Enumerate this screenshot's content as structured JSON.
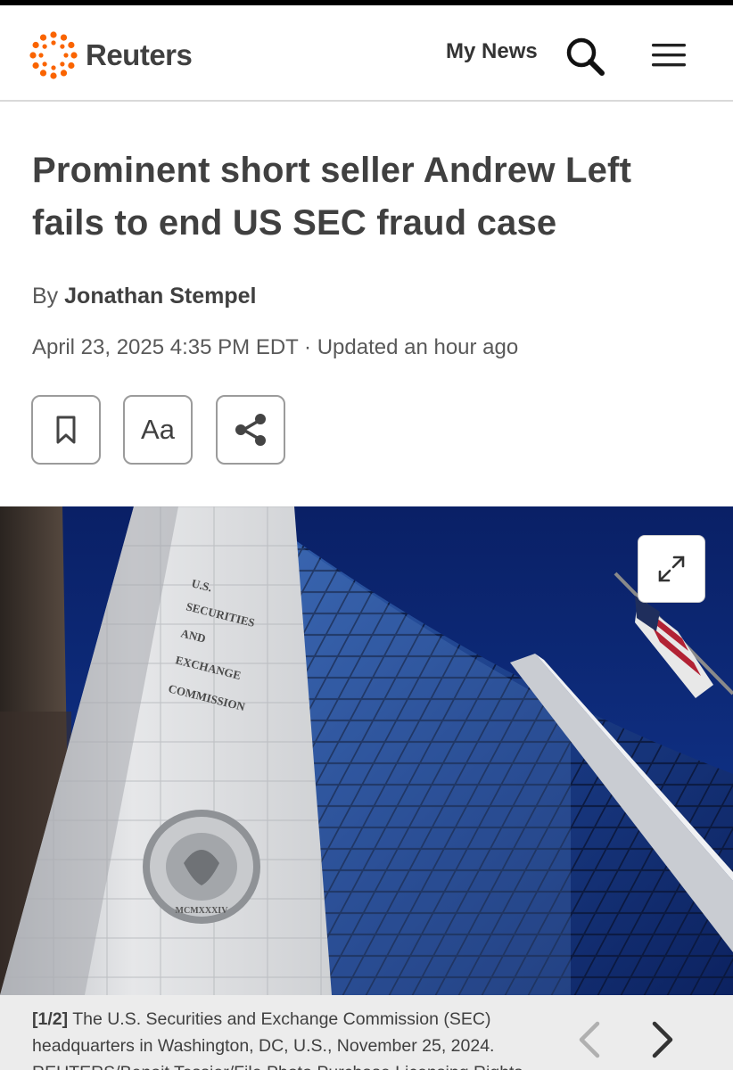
{
  "header": {
    "logo_text": "Reuters",
    "my_news": "My News",
    "search_icon": "search-icon",
    "menu_icon": "hamburger-menu-icon"
  },
  "article": {
    "headline": "Prominent short seller Andrew Left fails to end US SEC fraud case",
    "by_prefix": "By",
    "author": "Jonathan Stempel",
    "date": "April 23, 2025 4:35 PM EDT · Updated an hour ago",
    "tools": {
      "bookmark_icon": "bookmark-icon",
      "font_label": "Aa",
      "share_icon": "share-icon"
    }
  },
  "image": {
    "counter": "[1/2]",
    "caption": "The U.S. Securities and Exchange Commission (SEC) headquarters in Washington, DC, U.S., November 25, 2024. REUTERS/Benoit Tessier/File Photo Purchase Licensing Rights",
    "building_text": [
      "U.S.",
      "SECURITIES",
      "AND",
      "EXCHANGE",
      "COMMISSION"
    ],
    "seal_text": "MCMXXXIV"
  },
  "colors": {
    "brand_orange": "#fa6400",
    "text": "#404040",
    "sky": "#0d2a78"
  }
}
